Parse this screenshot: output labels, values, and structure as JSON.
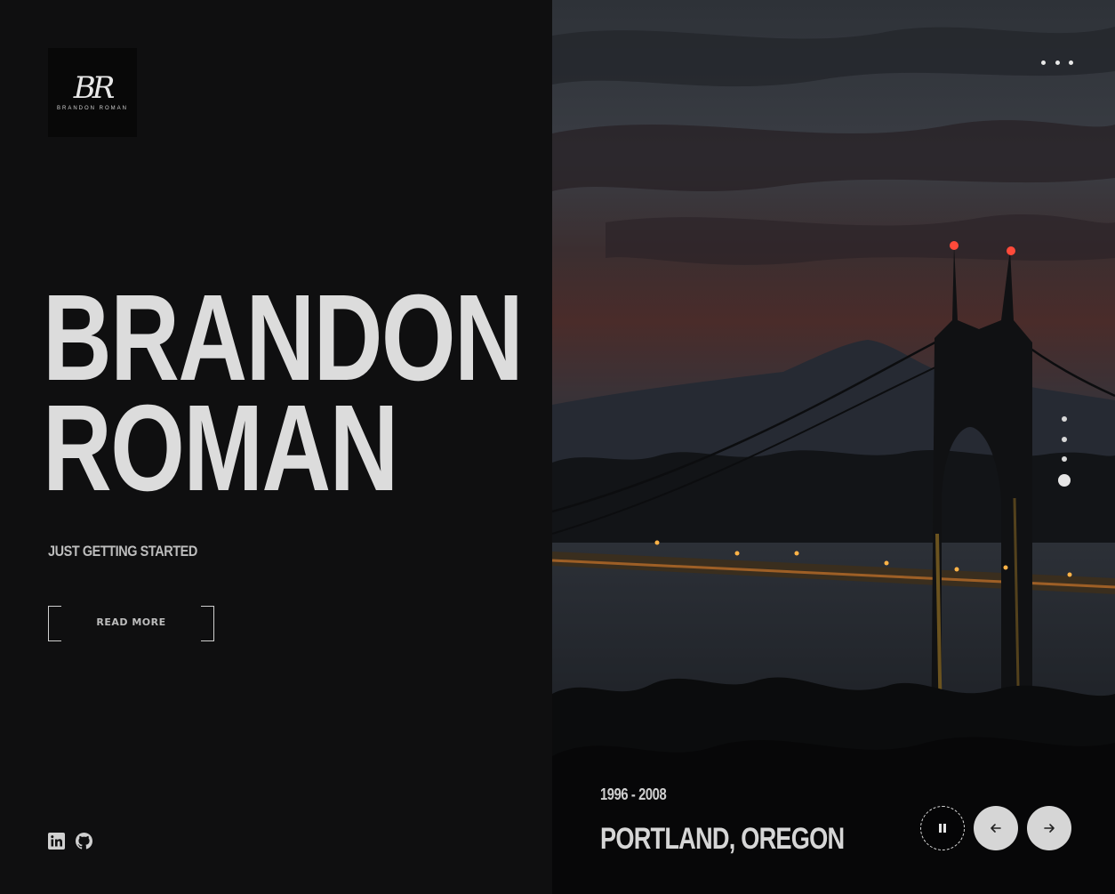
{
  "brand": {
    "logo_mark": "BR",
    "logo_text": "BRANDON ROMAN"
  },
  "hero": {
    "title_line1": "BRANDON",
    "title_line2": "ROMAN",
    "tagline": "JUST GETTING STARTED",
    "read_more_label": "READ MORE"
  },
  "socials": [
    {
      "icon": "linkedin-icon"
    },
    {
      "icon": "github-icon"
    }
  ],
  "slide": {
    "years": "1996 - 2008",
    "place": "PORTLAND, OREGON",
    "pager_count": 4,
    "active_index": 3
  },
  "controls": {
    "pause_icon": "pause-icon",
    "prev_icon": "arrow-left-icon",
    "next_icon": "arrow-right-icon",
    "menu_icon": "more-dots-icon"
  },
  "colors": {
    "background": "#0f0f10",
    "text": "#dcdcdc",
    "accent_light": "#d6d6d6"
  }
}
